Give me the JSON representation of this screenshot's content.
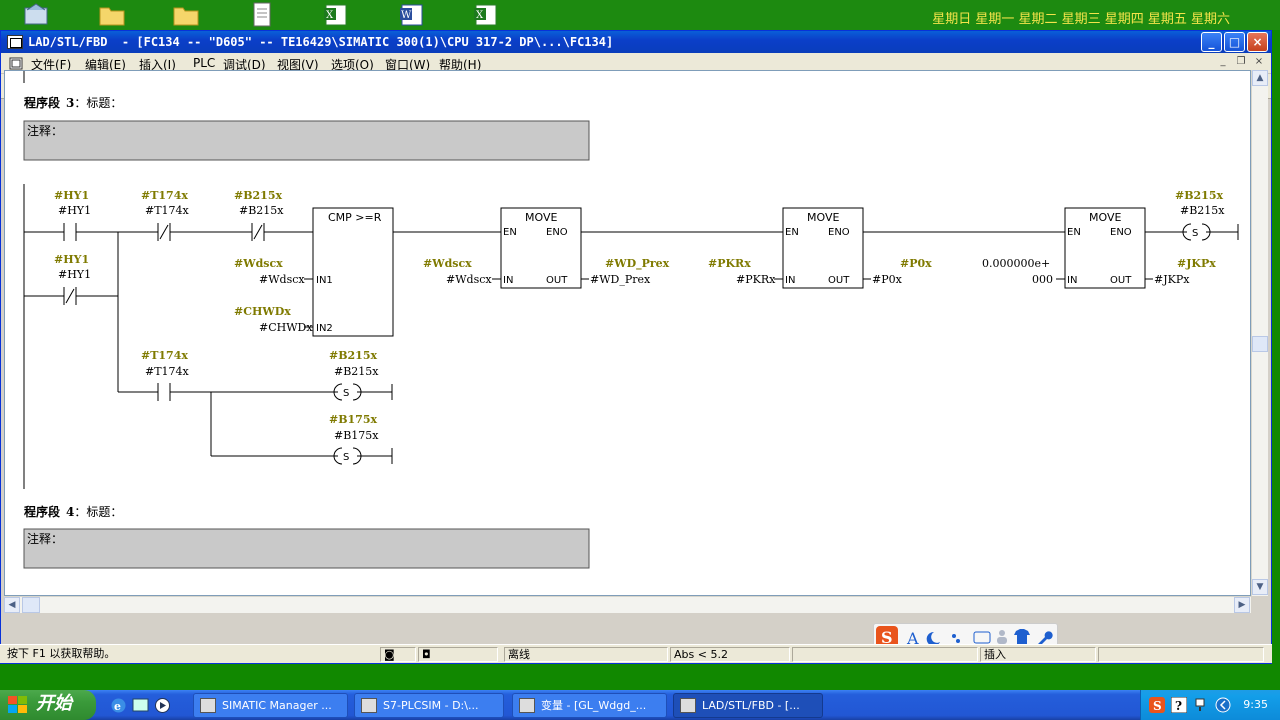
{
  "desktop": {
    "weekdays": "星期日 星期一 星期二 星期三 星期四 星期五 星期六"
  },
  "window": {
    "title": "LAD/STL/FBD  - [FC134 -- \"D605\" -- TE16429\\SIMATIC 300(1)\\CPU 317-2 DP\\...\\FC134]",
    "min_label": "_",
    "max_label": "□",
    "close_label": "×"
  },
  "menu": [
    "文件(F)",
    "编辑(E)",
    "插入(I)",
    "PLC",
    "调试(D)",
    "视图(V)",
    "选项(O)",
    "窗口(W)",
    "帮助(H)"
  ],
  "network3": {
    "title_prefix": "程序段",
    "number": "3",
    "title_suffix": "：标题：",
    "comment_label": "注释："
  },
  "network4": {
    "title_prefix": "程序段",
    "number": "4",
    "title_suffix": "：标题：",
    "comment_label": "注释："
  },
  "ladder": {
    "c1_sym": "#HY1",
    "c1_op": "#HY1",
    "c2_sym": "#T174x",
    "c2_op": "#T174x",
    "c3_sym": "#B215x",
    "c3_op": "#B215x",
    "c4_sym": "#HY1",
    "c4_op": "#HY1",
    "cmp_title": "CMP >=R",
    "cmp_in1_sym": "#Wdscx",
    "cmp_in1_op": "#Wdscx",
    "cmp_in1_pin": "IN1",
    "cmp_in2_sym": "#CHWDx",
    "cmp_in2_op": "#CHWDx",
    "cmp_in2_pin": "IN2",
    "move1_title": "MOVE",
    "move1_in_sym": "#Wdscx",
    "move1_in_op": "#Wdscx",
    "move1_out_sym": "#WD_Prex",
    "move1_out_op": "#WD_Prex",
    "move2_title": "MOVE",
    "move2_in_sym": "#PKRx",
    "move2_in_op": "#PKRx",
    "move2_out_sym": "#P0x",
    "move2_out_op": "#P0x",
    "move3_title": "MOVE",
    "move3_in_op_line1": "0.000000e+",
    "move3_in_op_line2": "000",
    "move3_out_sym": "#JKPx",
    "move3_out_op": "#JKPx",
    "coil1_sym": "#B215x",
    "coil1_op": "#B215x",
    "coil1_type": "S",
    "c5_sym": "#T174x",
    "c5_op": "#T174x",
    "coil2_sym": "#B215x",
    "coil2_op": "#B215x",
    "coil2_type": "S",
    "coil3_sym": "#B175x",
    "coil3_op": "#B175x",
    "coil3_type": "S",
    "pin_en": "EN",
    "pin_eno": "ENO",
    "pin_in": "IN",
    "pin_out": "OUT"
  },
  "status": {
    "help": "按下 F1 以获取帮助。",
    "mode": "离线",
    "abs": "Abs < 5.2",
    "insert": "插入"
  },
  "taskbar": {
    "start": "开始",
    "tasks": [
      "SIMATIC Manager ...",
      "S7-PLCSIM - D:\\...",
      "变量 - [GL_Wdgd_...",
      "LAD/STL/FBD  - [..."
    ],
    "clock": "9:35"
  },
  "colors": {
    "symbol": "#7f7a00",
    "titlebar": "#0a3dbb",
    "taskbar": "#245edb"
  }
}
